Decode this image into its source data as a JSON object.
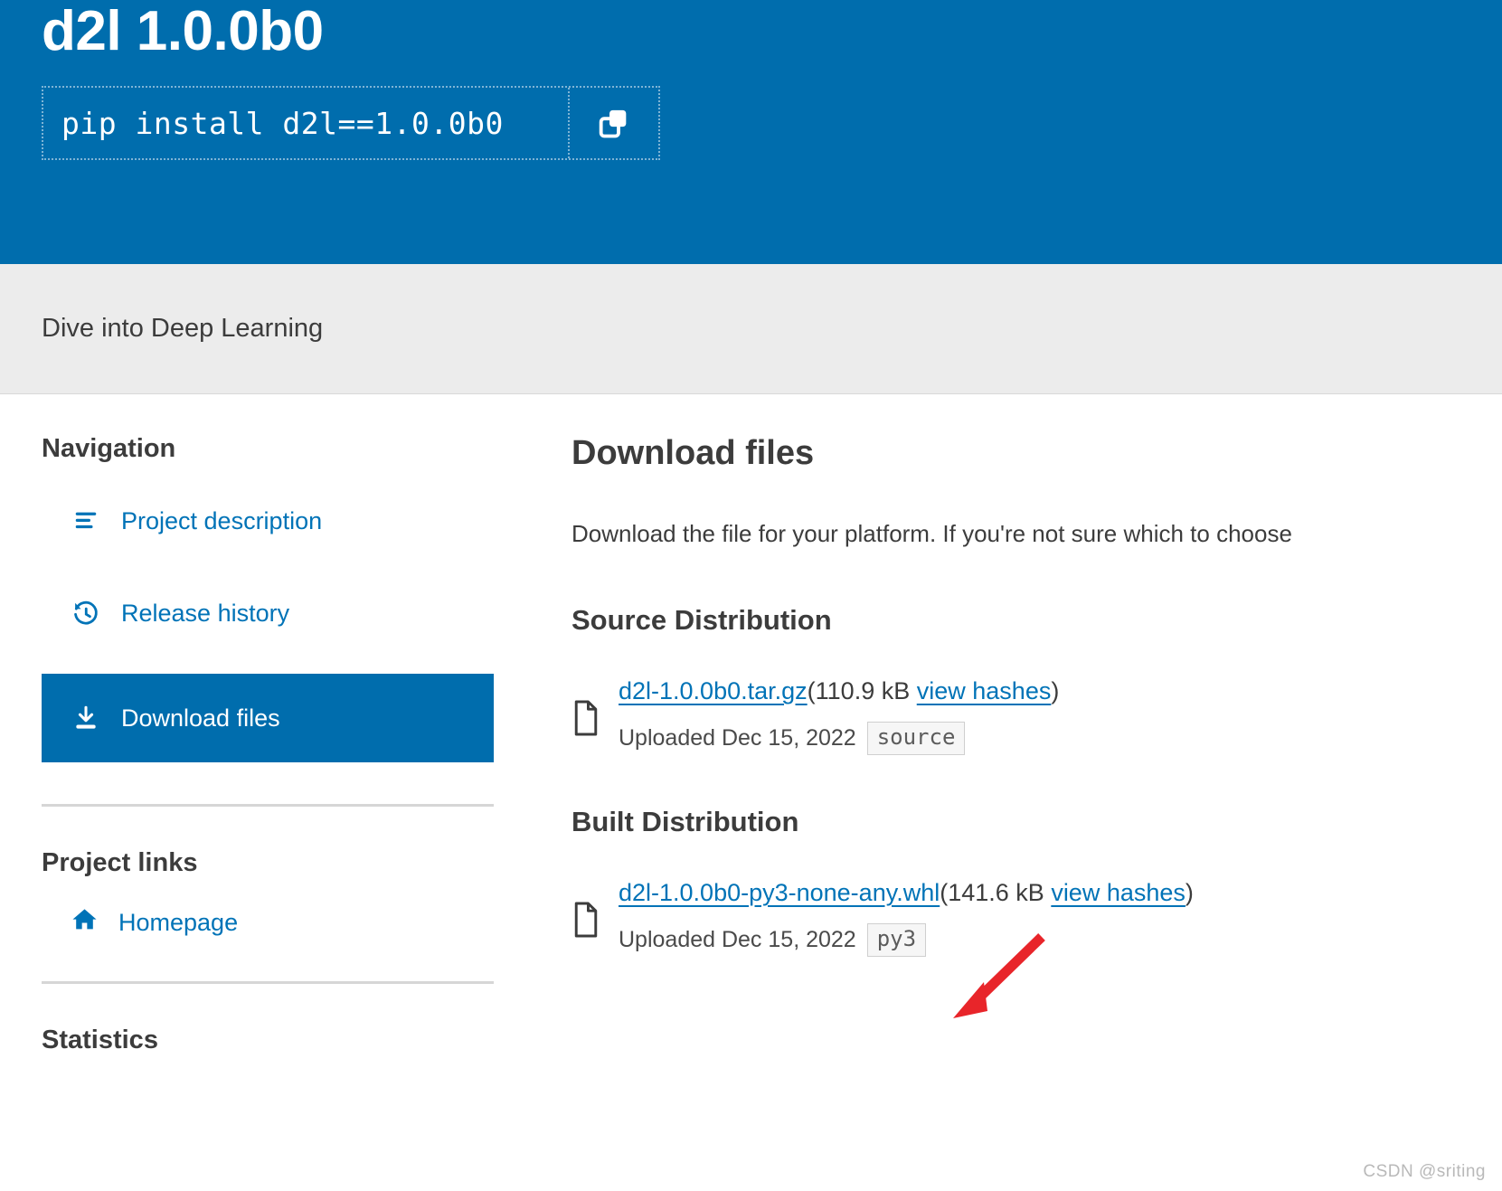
{
  "banner": {
    "title": "d2l 1.0.0b0",
    "pip_command": "pip install d2l==1.0.0b0",
    "copy_icon": "copy-icon",
    "background_color": "#006dad"
  },
  "subtitle": "Dive into Deep Learning",
  "sidebar": {
    "nav_heading": "Navigation",
    "nav_items": [
      {
        "label": "Project description",
        "icon": "list-lines-icon",
        "active": false
      },
      {
        "label": "Release history",
        "icon": "history-clock-icon",
        "active": false
      },
      {
        "label": "Download files",
        "icon": "download-icon",
        "active": true
      }
    ],
    "project_links_heading": "Project links",
    "project_links": [
      {
        "label": "Homepage",
        "icon": "home-icon"
      }
    ],
    "statistics_heading": "Statistics"
  },
  "main": {
    "title": "Download files",
    "lead": "Download the file for your platform. If you're not sure which to choose",
    "sections": [
      {
        "heading": "Source Distribution",
        "files": [
          {
            "icon": "file-icon",
            "filename": "d2l-1.0.0b0.tar.gz",
            "size_open": "(",
            "size": "110.9 kB",
            "hashes_label": "view hashes",
            "size_close": ")",
            "uploaded": "Uploaded Dec 15, 2022",
            "badge": "source"
          }
        ]
      },
      {
        "heading": "Built Distribution",
        "files": [
          {
            "icon": "file-icon",
            "filename": "d2l-1.0.0b0-py3-none-any.whl",
            "size_open": "(",
            "size": "141.6 kB",
            "hashes_label": "view hashes",
            "size_close": ")",
            "uploaded": "Uploaded Dec 15, 2022",
            "badge": "py3"
          }
        ]
      }
    ]
  },
  "annotation": {
    "arrow_color": "#e8252a",
    "name": "red-arrow-annotation"
  },
  "watermark": "CSDN @sriting",
  "colors": {
    "brand_blue": "#006dad",
    "link_blue": "#0073b7",
    "subtitle_bg": "#ececec",
    "text_dark": "#3c3c3c"
  }
}
